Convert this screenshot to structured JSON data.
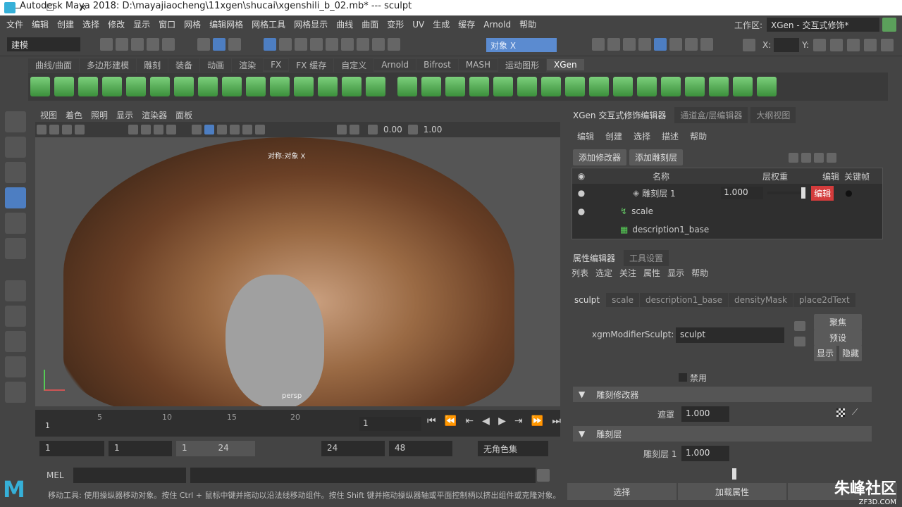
{
  "window": {
    "title": "Autodesk Maya 2018: D:\\mayajiaocheng\\11xgen\\shucai\\xgenshili_b_02.mb*  ---   sculpt",
    "min": "—",
    "max": "☐",
    "close": "✕"
  },
  "menubar": [
    "文件",
    "编辑",
    "创建",
    "选择",
    "修改",
    "显示",
    "窗口",
    "网格",
    "编辑网格",
    "网格工具",
    "网格显示",
    "曲线",
    "曲面",
    "变形",
    "UV",
    "生成",
    "缓存",
    "Arnold",
    "帮助"
  ],
  "workspace": {
    "label": "工作区:",
    "value": "XGen - 交互式修饰*"
  },
  "status": {
    "mode": "建模",
    "symmetry": "对象 X",
    "x_label": "X:",
    "y_label": "Y:"
  },
  "shelf_tabs": [
    "曲线/曲面",
    "多边形建模",
    "雕刻",
    "装备",
    "动画",
    "渲染",
    "FX",
    "FX 缓存",
    "自定义",
    "Arnold",
    "Bifrost",
    "MASH",
    "运动图形",
    "XGen"
  ],
  "shelf_active": "XGen",
  "viewport": {
    "menu": [
      "视图",
      "着色",
      "照明",
      "显示",
      "渲染器",
      "面板"
    ],
    "value_a": "0.00",
    "value_b": "1.00",
    "symmetry_label": "对称:对象 X",
    "camera_label": "persp"
  },
  "timeline": {
    "ticks": [
      "1",
      "5",
      "10",
      "15",
      "20"
    ],
    "current_frame": "1",
    "start": "1",
    "range_start": "1",
    "range_slider_start": "1",
    "range_slider_end": "24",
    "range_end": "24",
    "end": "48",
    "char_set": "无角色集"
  },
  "mel": {
    "label": "MEL"
  },
  "help_line": "移动工具: 使用操纵器移动对象。按住 Ctrl + 鼠标中键并拖动以沿法线移动组件。按住 Shift 键并拖动操纵器轴或平面控制柄以挤出组件或克隆对象。",
  "right_panel": {
    "tabs": [
      "XGen 交互式修饰编辑器",
      "通道盒/层编辑器",
      "大纲视图"
    ],
    "menu": [
      "编辑",
      "创建",
      "选择",
      "描述",
      "帮助"
    ],
    "add_modifier": "添加修改器",
    "add_sculpt_layer": "添加雕刻层",
    "tree_headers": {
      "name": "名称",
      "weight": "层权重",
      "edit": "编辑",
      "keyframe": "关键帧"
    },
    "tree_rows": [
      {
        "name": "雕刻层 1",
        "weight": "1.000",
        "edit": "编辑"
      },
      {
        "name": "scale"
      },
      {
        "name": "description1_base"
      }
    ],
    "attr_tabs_header": [
      "属性编辑器",
      "工具设置"
    ],
    "attr_menu": [
      "列表",
      "选定",
      "关注",
      "属性",
      "显示",
      "帮助"
    ],
    "attr_tabs": [
      "sculpt",
      "scale",
      "description1_base",
      "densityMask",
      "place2dText"
    ],
    "node_label": "xgmModifierSculpt:",
    "node_value": "sculpt",
    "side_buttons": [
      "聚焦",
      "预设",
      "显示",
      "隐藏"
    ],
    "disable_label": "禁用",
    "section1": "雕刻修改器",
    "mask_label": "遮罩",
    "mask_value": "1.000",
    "mask_level": 1.0,
    "section2": "雕刻层",
    "layer_label": "雕刻层 1",
    "layer_value": "1.000",
    "layer_level": 1.0,
    "bottom_buttons": [
      "选择",
      "加载属性"
    ]
  },
  "watermark": {
    "text": "朱峰社区",
    "sub": "ZF3D.COM"
  }
}
